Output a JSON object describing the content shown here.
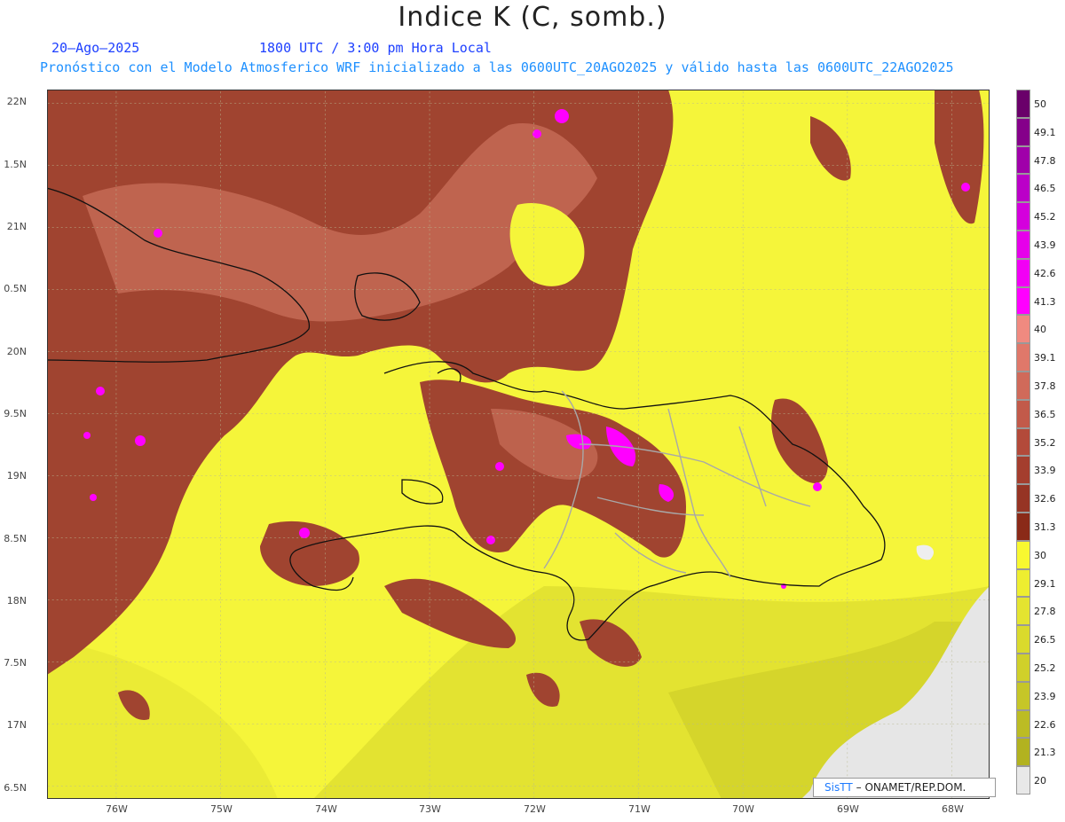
{
  "header": {
    "title": "Indice K (C, somb.)",
    "date": "20–Ago–2025",
    "time": "1800 UTC / 3:00 pm Hora Local",
    "description": "Pronóstico con el Modelo Atmosferico WRF inicializado a las 0600UTC_20AGO2025 y válido hasta las  0600UTC_22AGO2025"
  },
  "axes": {
    "lat_labels": [
      "22N",
      "1.5N",
      "21N",
      "0.5N",
      "20N",
      "9.5N",
      "19N",
      "8.5N",
      "18N",
      "7.5N",
      "17N",
      "6.5N"
    ],
    "lon_labels": [
      "76W",
      "75W",
      "74W",
      "73W",
      "72W",
      "71W",
      "70W",
      "69W",
      "68W"
    ]
  },
  "colorbar": {
    "labels": [
      "50",
      "49.1",
      "47.8",
      "46.5",
      "45.2",
      "43.9",
      "42.6",
      "41.3",
      "40",
      "39.1",
      "37.8",
      "36.5",
      "35.2",
      "33.9",
      "32.6",
      "31.3",
      "30",
      "29.1",
      "27.8",
      "26.5",
      "25.2",
      "23.9",
      "22.6",
      "21.3",
      "20"
    ],
    "colors": [
      "#6a006a",
      "#85008a",
      "#a000aa",
      "#bb00c8",
      "#d400dd",
      "#e600ea",
      "#f200f5",
      "#ff00ff",
      "#f08a80",
      "#e0786a",
      "#d06a5a",
      "#c25a4a",
      "#b34a3a",
      "#a43e2e",
      "#963424",
      "#8a2a18",
      "#f8f830",
      "#eeee30",
      "#e4e430",
      "#dada2c",
      "#d0d02a",
      "#c6c628",
      "#bcbc24",
      "#b2b220",
      "#e8e8e8"
    ]
  },
  "credit": {
    "logo": "SisTT",
    "text": "– ONAMET/REP.DOM."
  }
}
